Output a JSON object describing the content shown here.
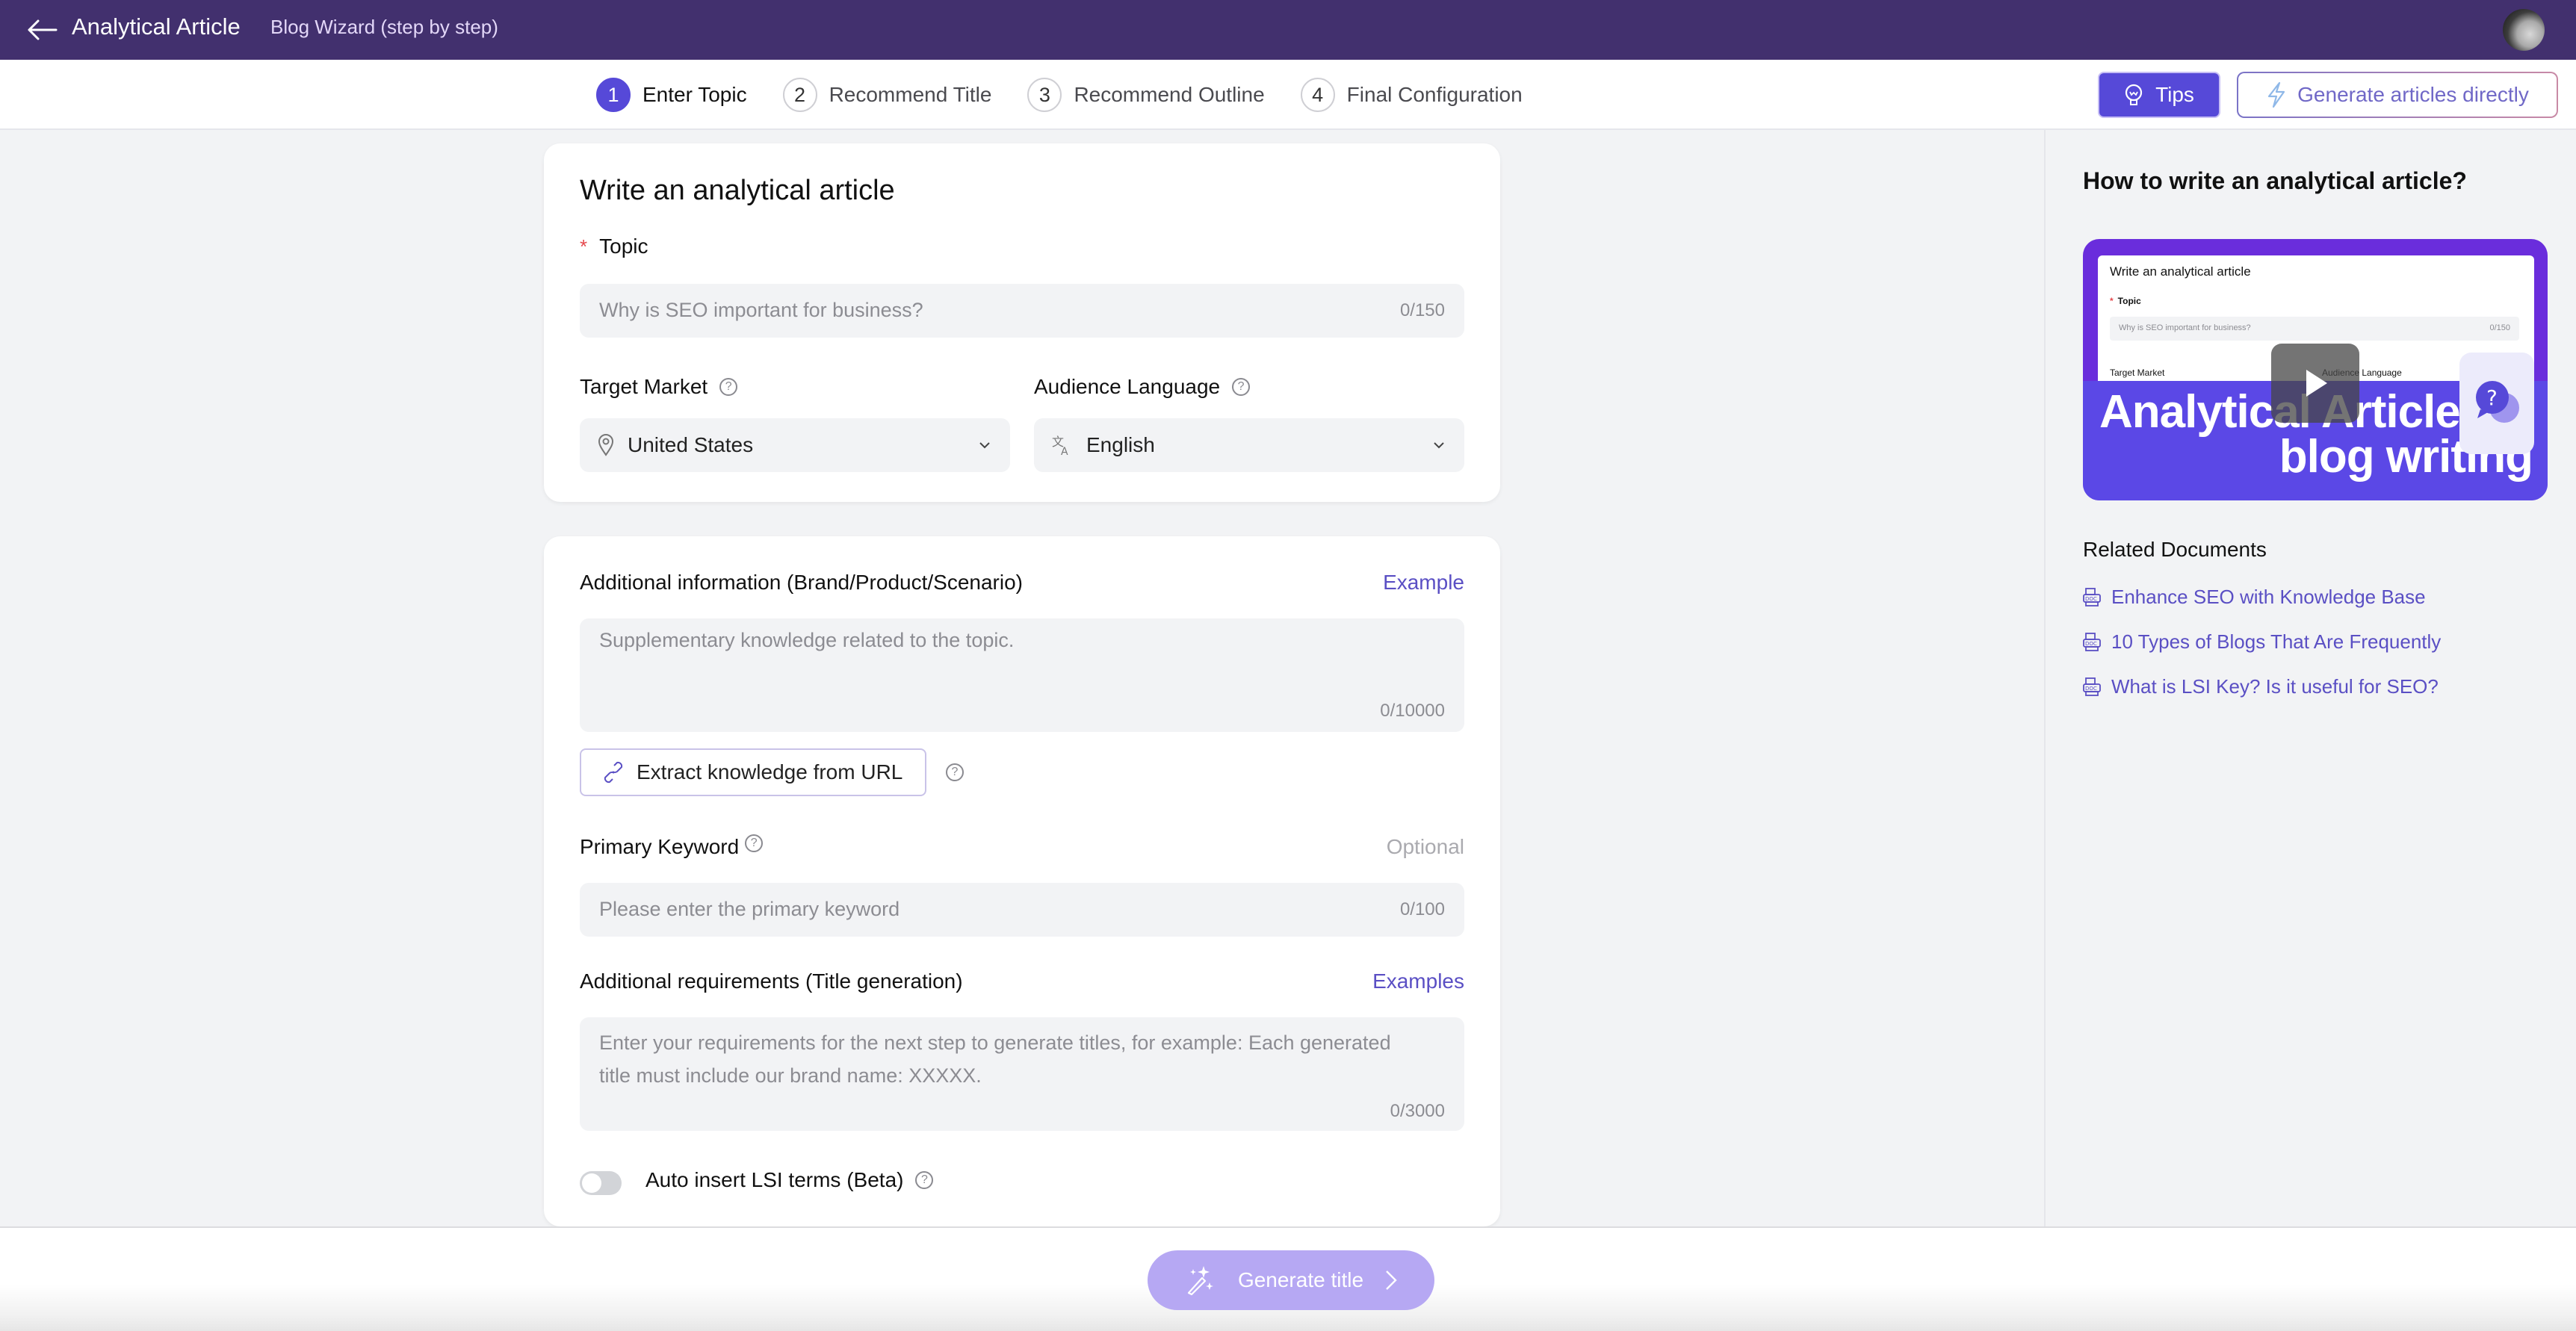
{
  "header": {
    "title": "Analytical Article",
    "subtitle": "Blog Wizard (step by step)"
  },
  "stepper": {
    "steps": [
      {
        "number": "1",
        "label": "Enter Topic",
        "active": true
      },
      {
        "number": "2",
        "label": "Recommend Title",
        "active": false
      },
      {
        "number": "3",
        "label": "Recommend Outline",
        "active": false
      },
      {
        "number": "4",
        "label": "Final Configuration",
        "active": false
      }
    ],
    "tips_label": "Tips",
    "generate_direct_label": "Generate articles directly"
  },
  "form": {
    "title": "Write an analytical article",
    "topic": {
      "label": "Topic",
      "required_mark": "*",
      "placeholder": "Why is SEO important for business?",
      "count": "0/150"
    },
    "target_market": {
      "label": "Target Market",
      "value": "United States"
    },
    "audience_language": {
      "label": "Audience Language",
      "value": "English"
    },
    "additional_info": {
      "label": "Additional information (Brand/Product/Scenario)",
      "link": "Example",
      "placeholder": "Supplementary knowledge related to the topic.",
      "count": "0/10000"
    },
    "extract_url_label": "Extract knowledge from URL",
    "primary_keyword": {
      "label": "Primary Keyword",
      "optional": "Optional",
      "placeholder": "Please enter the primary keyword",
      "count": "0/100"
    },
    "additional_requirements": {
      "label": "Additional requirements (Title generation)",
      "link": "Examples",
      "placeholder": "Enter your requirements for the next step to generate titles, for example: Each generated title must include our brand name: XXXXX.",
      "count": "0/3000"
    },
    "lsi_toggle": {
      "label": "Auto insert LSI terms (Beta)",
      "enabled": false
    }
  },
  "sidebar": {
    "title": "How to write an analytical article?",
    "video": {
      "mini_title": "Write an analytical article",
      "mini_topic": "Topic",
      "mini_placeholder": "Why is SEO important for business?",
      "mini_count": "0/150",
      "mini_target_market": "Target Market",
      "mini_audience_language": "Audience Language",
      "caption_line1": "Analytical Article",
      "caption_line2": "blog writing"
    },
    "related_title": "Related Documents",
    "related_docs": [
      "Enhance SEO with Knowledge Base",
      "10 Types of Blogs That Are Frequently",
      "What is LSI Key? Is it useful for SEO?"
    ]
  },
  "footer": {
    "generate_title_label": "Generate title"
  },
  "colors": {
    "header_bg": "#42306e",
    "accent": "#5649d8",
    "link": "#5a4fc4",
    "button_disabled": "#b6a8f3",
    "required": "#e5484d"
  }
}
